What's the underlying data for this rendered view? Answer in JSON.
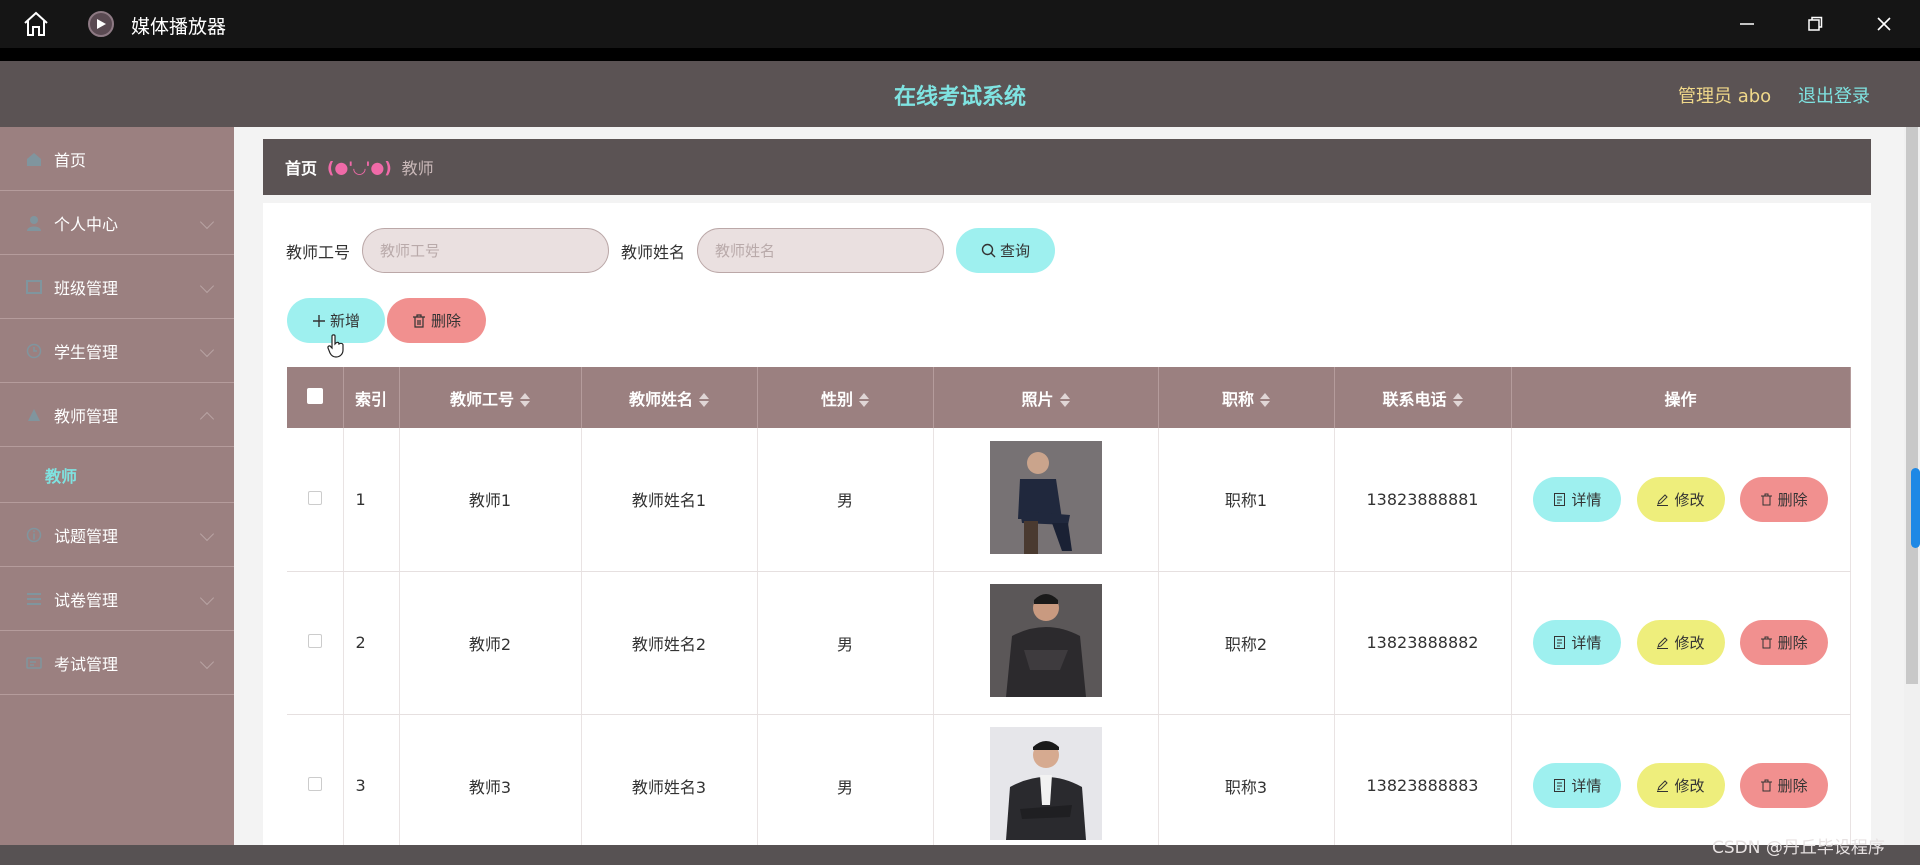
{
  "window": {
    "title": "媒体播放器"
  },
  "header": {
    "system_title": "在线考试系统",
    "admin_label": "管理员 abo",
    "logout_label": "退出登录"
  },
  "sidebar": {
    "items": [
      {
        "label": "首页",
        "icon": "home-icon",
        "expandable": false
      },
      {
        "label": "个人中心",
        "icon": "user-icon",
        "expandable": true
      },
      {
        "label": "班级管理",
        "icon": "class-icon",
        "expandable": true
      },
      {
        "label": "学生管理",
        "icon": "clock-icon",
        "expandable": true
      },
      {
        "label": "教师管理",
        "icon": "teacher-icon",
        "expandable": true,
        "expanded": true,
        "sub": [
          "教师"
        ]
      },
      {
        "label": "试题管理",
        "icon": "info-icon",
        "expandable": true
      },
      {
        "label": "试卷管理",
        "icon": "list-icon",
        "expandable": true
      },
      {
        "label": "考试管理",
        "icon": "card-icon",
        "expandable": true
      }
    ]
  },
  "breadcrumb": {
    "home": "首页",
    "separator": "(●'◡'●)",
    "current": "教师"
  },
  "search": {
    "id_label": "教师工号",
    "id_placeholder": "教师工号",
    "name_label": "教师姓名",
    "name_placeholder": "教师姓名",
    "query_button": "查询"
  },
  "actions": {
    "add": "新增",
    "delete": "删除"
  },
  "table": {
    "columns": [
      "索引",
      "教师工号",
      "教师姓名",
      "性别",
      "照片",
      "职称",
      "联系电话",
      "操作"
    ],
    "rows": [
      {
        "index": "1",
        "id": "教师1",
        "name": "教师姓名1",
        "gender": "男",
        "title": "职称1",
        "phone": "13823888881"
      },
      {
        "index": "2",
        "id": "教师2",
        "name": "教师姓名2",
        "gender": "男",
        "title": "职称2",
        "phone": "13823888882"
      },
      {
        "index": "3",
        "id": "教师3",
        "name": "教师姓名3",
        "gender": "男",
        "title": "职称3",
        "phone": "13823888883"
      }
    ],
    "row_actions": {
      "detail": "详情",
      "edit": "修改",
      "delete": "删除"
    }
  },
  "watermark": "CSDN @丹丘毕设程序",
  "colors": {
    "accent": "#7fe3e1",
    "header_bg": "#5b5354",
    "sidebar_bg": "#9b8080",
    "btn_cyan": "#9ef0ef",
    "btn_red": "#f1908f",
    "btn_yellow": "#eeee7c"
  }
}
